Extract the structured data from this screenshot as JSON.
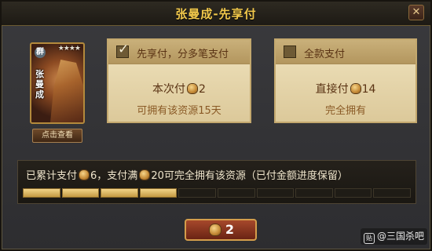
{
  "dialog": {
    "title": "张曼成-先享付",
    "close_icon": "close-icon"
  },
  "character": {
    "name": "张曼成",
    "kingdom": "群",
    "stars": "★★★★"
  },
  "view_button": "点击查看",
  "option_installment": {
    "checked": true,
    "title": "先享付，分多笔支付",
    "line1_prefix": "本次付",
    "line1_amount": "2",
    "line2": "可拥有该资源15天"
  },
  "option_full": {
    "checked": false,
    "title": "全款支付",
    "line1_prefix": "直接付",
    "line1_amount": "14",
    "line2": "完全拥有"
  },
  "progress": {
    "text_part1": "已累计支付",
    "paid": "6",
    "text_part2": "，支付满",
    "total": "20",
    "text_part3": "可完全拥有该资源（已付金额进度保留）",
    "segments_total": 10,
    "segments_filled": 4
  },
  "pay_button": {
    "amount": "2"
  },
  "watermark": "@三国杀吧",
  "colors": {
    "accent_gold": "#f2c94c",
    "progress_fill": "#e0b95e",
    "pay_button": "#8a3520"
  }
}
